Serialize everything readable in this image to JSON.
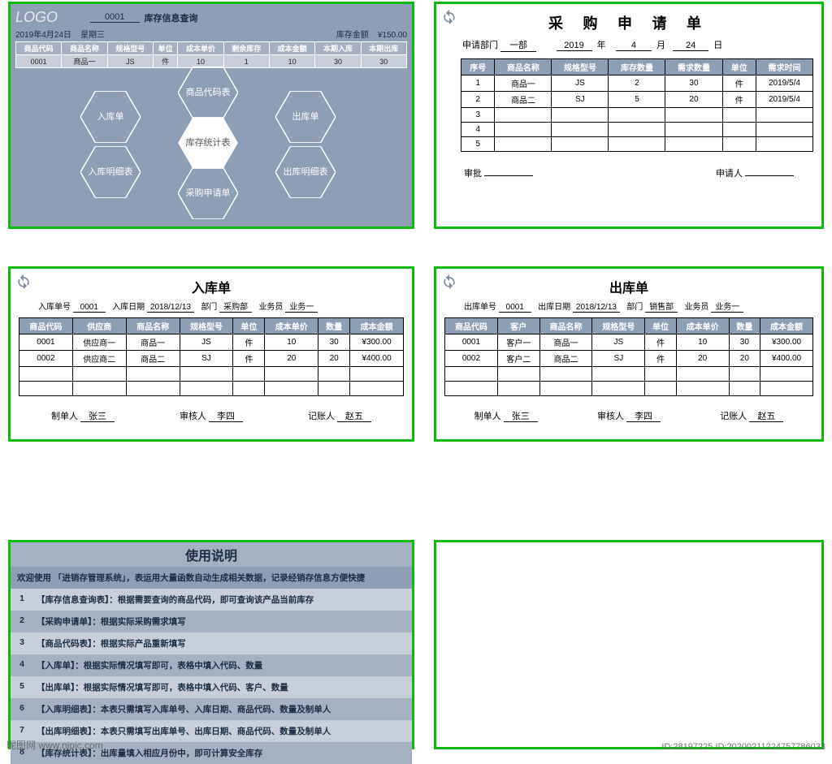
{
  "panel1": {
    "logo": "LOGO",
    "code": "0001",
    "title": "库存信息查询",
    "date": "2019年4月24日",
    "weekday": "星期三",
    "amt_label": "库存金额",
    "amt": "¥150.00",
    "cols": [
      "商品代码",
      "商品名称",
      "规格型号",
      "单位",
      "成本单价",
      "剩余库存",
      "成本金额",
      "本期入库",
      "本期出库"
    ],
    "row": [
      "0001",
      "商品一",
      "JS",
      "件",
      "10",
      "1",
      "10",
      "30",
      "30"
    ],
    "hex": {
      "center": "库存统计表",
      "tl": "入库单",
      "tr": "出库单",
      "ml": "入库明细表",
      "mr": "出库明细表",
      "top": "商品代码表",
      "bot": "采购申请单"
    }
  },
  "panel2": {
    "title": "采 购 申 请 单",
    "dept_label": "申请部门",
    "dept": "一部",
    "year": "2019",
    "y_lab": "年",
    "month": "4",
    "m_lab": "月",
    "day": "24",
    "d_lab": "日",
    "cols": [
      "序号",
      "商品名称",
      "规格型号",
      "库存数量",
      "需求数量",
      "单位",
      "需求时间"
    ],
    "rows": [
      [
        "1",
        "商品一",
        "JS",
        "2",
        "30",
        "件",
        "2019/5/4"
      ],
      [
        "2",
        "商品二",
        "SJ",
        "5",
        "20",
        "件",
        "2019/5/4"
      ],
      [
        "3",
        "",
        "",
        "",
        "",
        "",
        ""
      ],
      [
        "4",
        "",
        "",
        "",
        "",
        "",
        ""
      ],
      [
        "5",
        "",
        "",
        "",
        "",
        "",
        ""
      ]
    ],
    "approve": "审批",
    "applicant": "申请人"
  },
  "panel3": {
    "title": "入库单",
    "no_lab": "入库单号",
    "no": "0001",
    "date_lab": "入库日期",
    "date": "2018/12/13",
    "dept_lab": "部门",
    "dept": "采购部",
    "clerk_lab": "业务员",
    "clerk": "业务一",
    "cols": [
      "商品代码",
      "供应商",
      "商品名称",
      "规格型号",
      "单位",
      "成本单价",
      "数量",
      "成本金额"
    ],
    "rows": [
      [
        "0001",
        "供应商一",
        "商品一",
        "JS",
        "件",
        "10",
        "30",
        "¥300.00"
      ],
      [
        "0002",
        "供应商二",
        "商品二",
        "SJ",
        "件",
        "20",
        "20",
        "¥400.00"
      ],
      [
        "",
        "",
        "",
        "",
        "",
        "",
        "",
        ""
      ],
      [
        "",
        "",
        "",
        "",
        "",
        "",
        "",
        ""
      ]
    ],
    "s1l": "制单人",
    "s1": "张三",
    "s2l": "审核人",
    "s2": "李四",
    "s3l": "记账人",
    "s3": "赵五"
  },
  "panel4": {
    "title": "出库单",
    "no_lab": "出库单号",
    "no": "0001",
    "date_lab": "出库日期",
    "date": "2018/12/13",
    "dept_lab": "部门",
    "dept": "销售部",
    "clerk_lab": "业务员",
    "clerk": "业务一",
    "cols": [
      "商品代码",
      "客户",
      "商品名称",
      "规格型号",
      "单位",
      "成本单价",
      "数量",
      "成本金额"
    ],
    "rows": [
      [
        "0001",
        "客户一",
        "商品一",
        "JS",
        "件",
        "10",
        "30",
        "¥300.00"
      ],
      [
        "0002",
        "客户二",
        "商品二",
        "SJ",
        "件",
        "20",
        "20",
        "¥400.00"
      ],
      [
        "",
        "",
        "",
        "",
        "",
        "",
        "",
        ""
      ],
      [
        "",
        "",
        "",
        "",
        "",
        "",
        "",
        ""
      ]
    ],
    "s1l": "制单人",
    "s1": "张三",
    "s2l": "审核人",
    "s2": "李四",
    "s3l": "记账人",
    "s3": "赵五"
  },
  "panel5": {
    "title": "使用说明",
    "welcome": "欢迎使用 「进销存管理系统」，表运用大量函数自动生成相关数据，记录经销存信息方便快捷",
    "items": [
      "【库存信息查询表】：根据需要查询的商品代码，即可查询该产品当前库存",
      "【采购申请单】：根据实际采购需求填写",
      "【商品代码表】：根据实际产品重新填写",
      "【入库单】：根据实际情况填写即可，表格中填入代码、数量",
      "【出库单】：根据实际情况填写即可，表格中填入代码、客户、数量",
      "【入库明细表】：本表只需填写入库单号、入库日期、商品代码、数量及制单人",
      "【出库明细表】：本表只需填写出库单号、出库日期、商品代码、数量及制单人",
      "【库存统计表】：出库量填入相应月份中，即可计算安全库存"
    ]
  },
  "watermark": {
    "bl": "昵图网 www.nipic.com",
    "br": "ID:28197225 ID:20200211224757786033"
  }
}
